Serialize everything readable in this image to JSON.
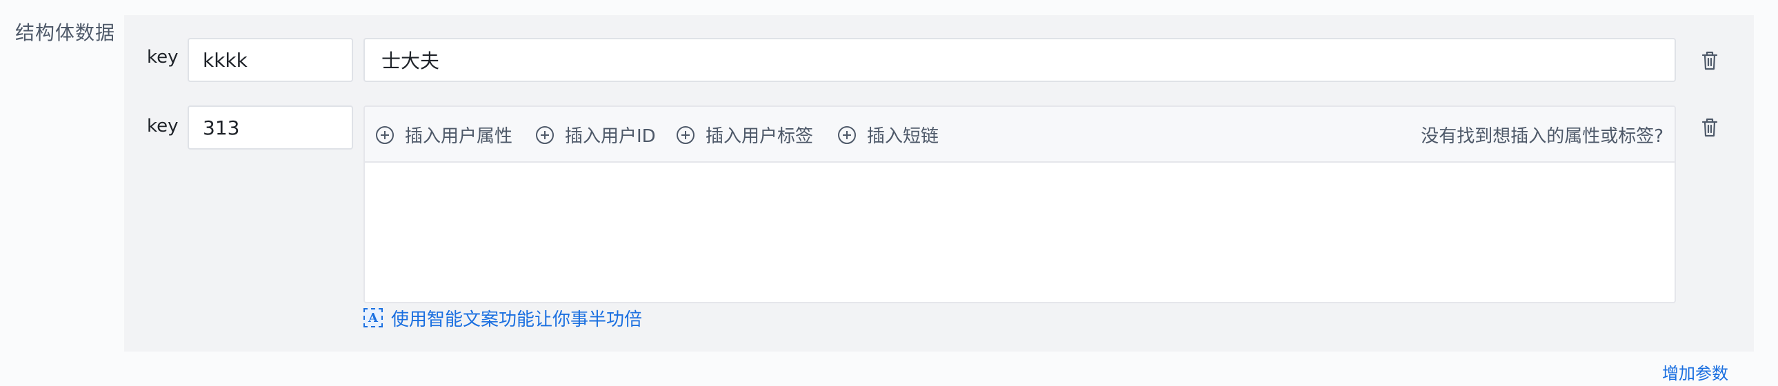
{
  "section": {
    "label": "结构体数据"
  },
  "rows": [
    {
      "key_label": "key",
      "key_value": "kkkk",
      "value": "士大夫"
    },
    {
      "key_label": "key",
      "key_value": "313",
      "value": ""
    }
  ],
  "editor": {
    "toolbar": [
      {
        "label": "插入用户属性",
        "icon": "plus-circle-icon"
      },
      {
        "label": "插入用户ID",
        "icon": "plus-circle-icon"
      },
      {
        "label": "插入用户标签",
        "icon": "plus-circle-icon"
      },
      {
        "label": "插入短链",
        "icon": "plus-circle-icon"
      }
    ],
    "help_link": "没有找到想插入的属性或标签?"
  },
  "ai_tip": {
    "label": "使用智能文案功能让你事半功倍",
    "icon": "ai-text-icon"
  },
  "add_param": {
    "label": "增加参数"
  },
  "colors": {
    "link": "#1a6fe0",
    "panel_bg": "#f2f3f5",
    "toolbar_bg": "#f7f8fa"
  }
}
